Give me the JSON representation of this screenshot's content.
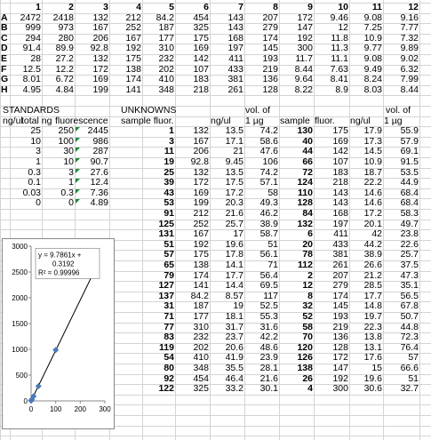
{
  "col_headers": [
    "1",
    "2",
    "3",
    "4",
    "5",
    "6",
    "7",
    "8",
    "9",
    "10",
    "11",
    "12"
  ],
  "row_headers": [
    "A",
    "B",
    "C",
    "D",
    "E",
    "F",
    "G",
    "H"
  ],
  "plate": [
    [
      "2472",
      "2418",
      "132",
      "212",
      "84.2",
      "454",
      "143",
      "207",
      "172",
      "9.46",
      "9.08",
      "9.16"
    ],
    [
      "999",
      "973",
      "167",
      "252",
      "187",
      "325",
      "143",
      "279",
      "147",
      "12",
      "7.25",
      "7.77"
    ],
    [
      "294",
      "280",
      "206",
      "167",
      "177",
      "175",
      "168",
      "174",
      "192",
      "11.8",
      "10.9",
      "7.32"
    ],
    [
      "91.4",
      "89.9",
      "92.8",
      "192",
      "310",
      "169",
      "197",
      "145",
      "300",
      "11.3",
      "9.77",
      "9.89"
    ],
    [
      "28",
      "27.2",
      "132",
      "175",
      "232",
      "142",
      "411",
      "193",
      "11.7",
      "11.1",
      "9.08",
      "9.02"
    ],
    [
      "12.5",
      "12.2",
      "172",
      "138",
      "202",
      "107",
      "433",
      "219",
      "8.44",
      "7.63",
      "9.49",
      "6.32"
    ],
    [
      "8.01",
      "6.72",
      "169",
      "174",
      "410",
      "183",
      "381",
      "136",
      "9.64",
      "8.41",
      "8.24",
      "7.99"
    ],
    [
      "4.95",
      "4.84",
      "199",
      "141",
      "348",
      "218",
      "261",
      "128",
      "8.22",
      "8.9",
      "8.03",
      "8.44"
    ]
  ],
  "standards": {
    "title": "STANDARDS",
    "headers": [
      "ng/ul",
      "total ng",
      "fluorescence"
    ],
    "rows": [
      [
        "25",
        "250",
        "2445"
      ],
      [
        "10",
        "100",
        "986"
      ],
      [
        "3",
        "30",
        "287"
      ],
      [
        "1",
        "10",
        "90.7"
      ],
      [
        "0.3",
        "3",
        "27.6"
      ],
      [
        "0.1",
        "1",
        "12.4"
      ],
      [
        "0.03",
        "0.3",
        "7.36"
      ],
      [
        "0",
        "0",
        "4.89"
      ]
    ]
  },
  "unknowns": {
    "title": "UNKNOWNS",
    "vol_label": "vol. of",
    "headers": [
      "sample fluor.",
      "",
      "ng/ul",
      "1 µg",
      "sample",
      "fluor.",
      "ng/ul",
      "1 µg"
    ],
    "rows": [
      [
        "1",
        "132",
        "13.5",
        "74.2",
        "130",
        "175",
        "17.9",
        "55.9"
      ],
      [
        "3",
        "167",
        "17.1",
        "58.6",
        "40",
        "169",
        "17.3",
        "57.9"
      ],
      [
        "11",
        "206",
        "21",
        "47.6",
        "44",
        "142",
        "14.5",
        "69.1"
      ],
      [
        "19",
        "92.8",
        "9.45",
        "106",
        "66",
        "107",
        "10.9",
        "91.5"
      ],
      [
        "25",
        "132",
        "13.5",
        "74.2",
        "72",
        "183",
        "18.7",
        "53.5"
      ],
      [
        "39",
        "172",
        "17.5",
        "57.1",
        "124",
        "218",
        "22.2",
        "44.9"
      ],
      [
        "43",
        "169",
        "17.2",
        "58",
        "110",
        "143",
        "14.6",
        "68.4"
      ],
      [
        "53",
        "199",
        "20.3",
        "49.3",
        "128",
        "143",
        "14.6",
        "68.4"
      ],
      [
        "91",
        "212",
        "21.6",
        "46.2",
        "84",
        "168",
        "17.2",
        "58.3"
      ],
      [
        "125",
        "252",
        "25.7",
        "38.9",
        "132",
        "197",
        "20.1",
        "49.7"
      ],
      [
        "131",
        "167",
        "17",
        "58.7",
        "6",
        "411",
        "42",
        "23.8"
      ],
      [
        "51",
        "192",
        "19.6",
        "51",
        "20",
        "433",
        "44.2",
        "22.6"
      ],
      [
        "57",
        "175",
        "17.8",
        "56.1",
        "78",
        "381",
        "38.9",
        "25.7"
      ],
      [
        "65",
        "138",
        "14.1",
        "71",
        "112",
        "261",
        "26.6",
        "37.5"
      ],
      [
        "79",
        "174",
        "17.7",
        "56.4",
        "2",
        "207",
        "21.2",
        "47.3"
      ],
      [
        "127",
        "141",
        "14.4",
        "69.5",
        "12",
        "279",
        "28.5",
        "35.1"
      ],
      [
        "137",
        "84.2",
        "8.57",
        "117",
        "8",
        "174",
        "17.7",
        "56.5"
      ],
      [
        "31",
        "187",
        "19",
        "52.5",
        "32",
        "145",
        "14.8",
        "67.8"
      ],
      [
        "71",
        "177",
        "18.1",
        "55.3",
        "52",
        "193",
        "19.7",
        "50.7"
      ],
      [
        "77",
        "310",
        "31.7",
        "31.6",
        "58",
        "219",
        "22.3",
        "44.8"
      ],
      [
        "83",
        "232",
        "23.7",
        "42.2",
        "70",
        "136",
        "13.8",
        "72.3"
      ],
      [
        "119",
        "202",
        "20.6",
        "48.6",
        "120",
        "128",
        "13.1",
        "76.4"
      ],
      [
        "54",
        "410",
        "41.9",
        "23.9",
        "126",
        "172",
        "17.6",
        "57"
      ],
      [
        "80",
        "348",
        "35.5",
        "28.1",
        "138",
        "147",
        "15",
        "66.6"
      ],
      [
        "92",
        "454",
        "46.4",
        "21.6",
        "26",
        "192",
        "19.6",
        "51"
      ],
      [
        "122",
        "325",
        "33.2",
        "30.1",
        "4",
        "300",
        "30.6",
        "32.7"
      ]
    ]
  },
  "chart_data": {
    "type": "scatter",
    "x": [
      250,
      100,
      30,
      10,
      3,
      1,
      0.3,
      0
    ],
    "y": [
      2445,
      986,
      287,
      90.7,
      27.6,
      12.4,
      7.36,
      4.89
    ],
    "trendline": {
      "slope": 9.7861,
      "intercept": 0.3192
    },
    "equation_text_1": "y = 9.7861x +",
    "equation_text_2": "0.3192",
    "r2_text": "R² = 0.99996",
    "xlim": [
      0,
      300
    ],
    "ylim": [
      0,
      3000
    ],
    "x_ticks": [
      "0",
      "100",
      "200",
      "300"
    ],
    "y_ticks": [
      "0",
      "500",
      "1000",
      "1500",
      "2000",
      "2500",
      "3000"
    ],
    "marker_color": "#4a7ab8",
    "line_color": "#000000"
  }
}
